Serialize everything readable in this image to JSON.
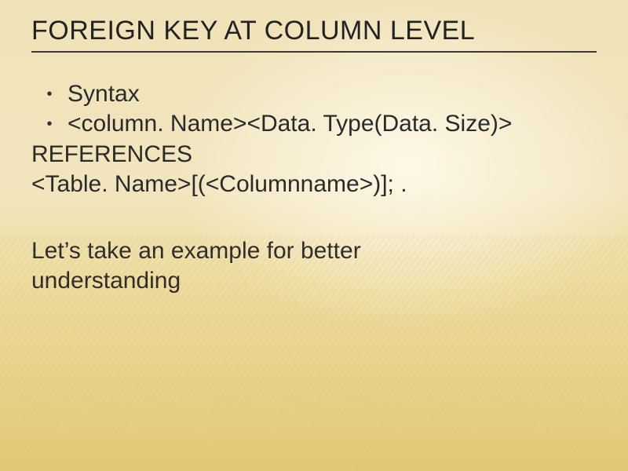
{
  "title": "FOREIGN KEY AT COLUMN LEVEL",
  "bullets": [
    "Syntax",
    "<column. Name><Data. Type(Data. Size)>"
  ],
  "continuation": [
    "REFERENCES",
    "<Table. Name>[(<Columnname>)]; ."
  ],
  "closing": [
    "Let’s take an example for better",
    "understanding"
  ]
}
